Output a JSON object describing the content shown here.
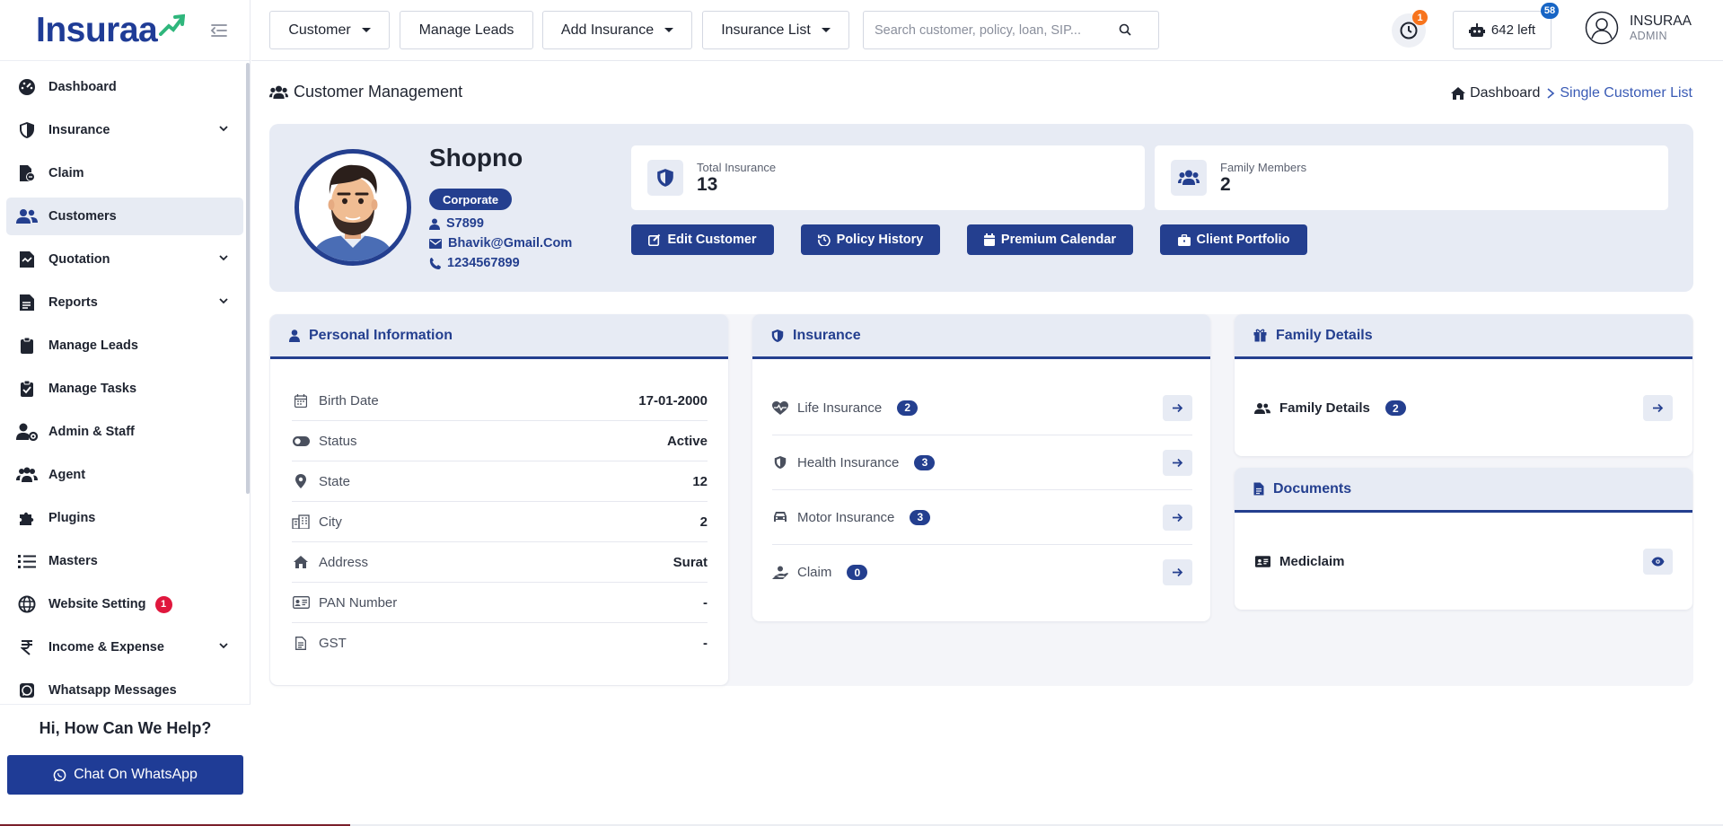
{
  "brand": {
    "logo_text": "Insuraa",
    "accent_color": "#243f8f",
    "logo_green": "#2fb67c"
  },
  "sidebar": {
    "items": [
      {
        "label": "Dashboard",
        "icon": "dashboard-icon",
        "chevron": false
      },
      {
        "label": "Insurance",
        "icon": "shield-icon",
        "chevron": true
      },
      {
        "label": "Claim",
        "icon": "claim-file-icon",
        "chevron": false
      },
      {
        "label": "Customers",
        "icon": "users-icon",
        "chevron": false,
        "active": true
      },
      {
        "label": "Quotation",
        "icon": "quotation-icon",
        "chevron": true
      },
      {
        "label": "Reports",
        "icon": "reports-icon",
        "chevron": true
      },
      {
        "label": "Manage Leads",
        "icon": "clipboard-icon",
        "chevron": false
      },
      {
        "label": "Manage Tasks",
        "icon": "clipboard-check-icon",
        "chevron": false
      },
      {
        "label": "Admin & Staff",
        "icon": "user-gear-icon",
        "chevron": false
      },
      {
        "label": "Agent",
        "icon": "agent-icon",
        "chevron": false
      },
      {
        "label": "Plugins",
        "icon": "puzzle-icon",
        "chevron": false
      },
      {
        "label": "Masters",
        "icon": "list-icon",
        "chevron": false
      },
      {
        "label": "Website Setting",
        "icon": "globe-icon",
        "chevron": false,
        "badge": "1"
      },
      {
        "label": "Income & Expense",
        "icon": "rupee-icon",
        "chevron": true
      },
      {
        "label": "Whatsapp Messages",
        "icon": "whatsapp-icon",
        "chevron": false
      }
    ],
    "help_title": "Hi, How Can We Help?",
    "chat_button": "Chat On WhatsApp"
  },
  "topbar": {
    "customer": "Customer",
    "manage_leads": "Manage Leads",
    "add_insurance": "Add Insurance",
    "insurance_list": "Insurance List",
    "search_placeholder": "Search customer, policy, loan, SIP...",
    "notification_count": "1",
    "credits_label": "642 left",
    "credits_badge": "58",
    "user_name": "INSURAA",
    "user_role": "ADMIN"
  },
  "page": {
    "title": "Customer Management",
    "breadcrumb_home": "Dashboard",
    "breadcrumb_current": "Single Customer List"
  },
  "customer": {
    "name": "Shopno",
    "type": "Corporate",
    "code": "S7899",
    "email": "Bhavik@Gmail.Com",
    "phone": "1234567899"
  },
  "stats": {
    "total_insurance_label": "Total Insurance",
    "total_insurance_value": "13",
    "family_members_label": "Family Members",
    "family_members_value": "2"
  },
  "actions": {
    "edit": "Edit Customer",
    "history": "Policy History",
    "calendar": "Premium Calendar",
    "portfolio": "Client Portfolio"
  },
  "personal": {
    "title": "Personal Information",
    "rows": [
      {
        "label": "Birth Date",
        "value": "17-01-2000"
      },
      {
        "label": "Status",
        "value": "Active"
      },
      {
        "label": "State",
        "value": "12"
      },
      {
        "label": "City",
        "value": "2"
      },
      {
        "label": "Address",
        "value": "Surat"
      },
      {
        "label": "PAN Number",
        "value": "-"
      },
      {
        "label": "GST",
        "value": "-"
      }
    ]
  },
  "insurance": {
    "title": "Insurance",
    "rows": [
      {
        "label": "Life Insurance",
        "count": "2"
      },
      {
        "label": "Health Insurance",
        "count": "3"
      },
      {
        "label": "Motor Insurance",
        "count": "3"
      },
      {
        "label": "Claim",
        "count": "0"
      }
    ]
  },
  "family": {
    "title": "Family Details",
    "row_label": "Family Details",
    "row_count": "2"
  },
  "documents": {
    "title": "Documents",
    "row_label": "Mediclaim"
  }
}
